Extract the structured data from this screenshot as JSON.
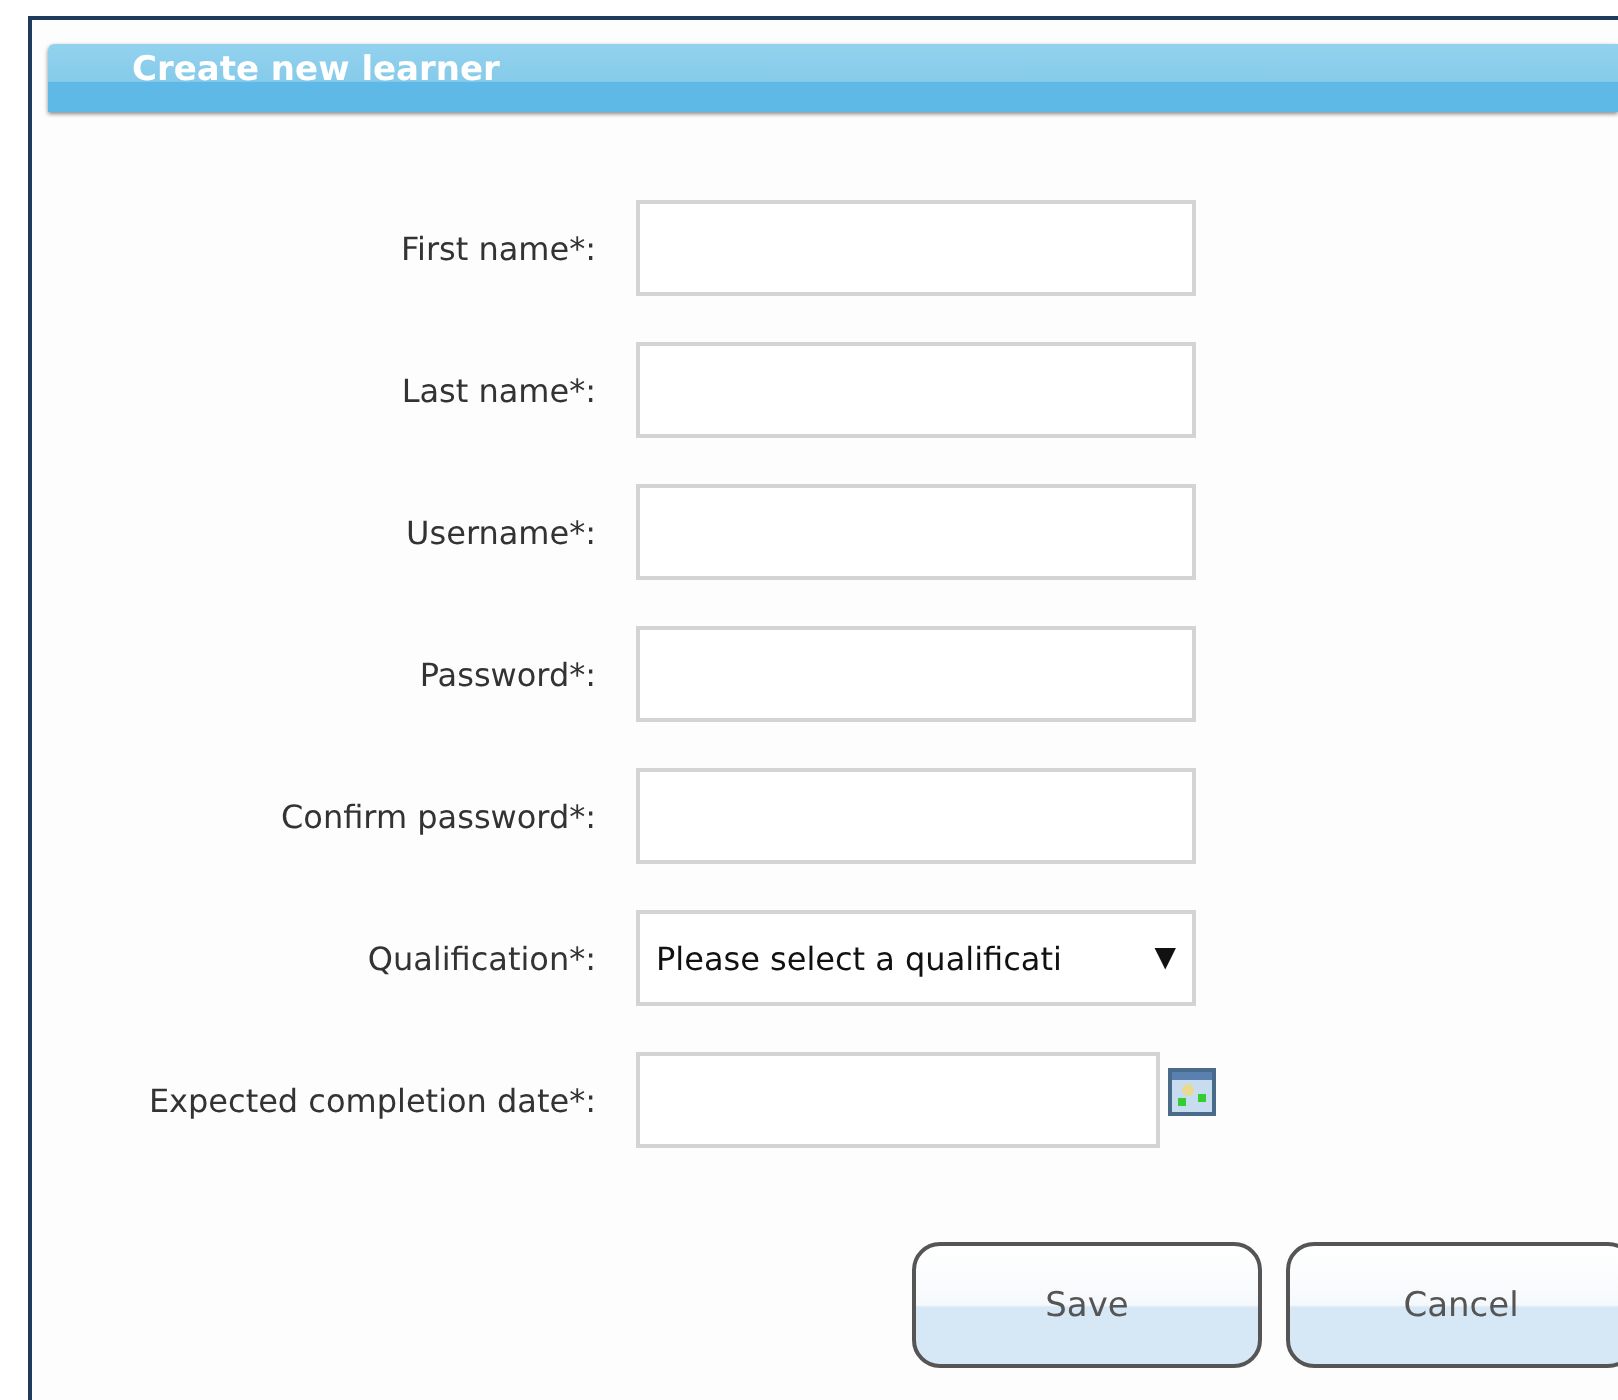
{
  "window": {
    "title": "Create new learner"
  },
  "fields": [
    {
      "label": "First name*:",
      "kind": "text"
    },
    {
      "label": "Last name*:",
      "kind": "text"
    },
    {
      "label": "Username*:",
      "kind": "text"
    },
    {
      "label": "Password*:",
      "kind": "text"
    },
    {
      "label": "Confirm password*:",
      "kind": "text"
    },
    {
      "label": "Qualification*:",
      "kind": "select",
      "value": "Please select a qualificati",
      "caret": "▼"
    },
    {
      "label": "Expected completion date*:",
      "kind": "date"
    }
  ],
  "buttons": [
    "Save",
    "Cancel"
  ]
}
